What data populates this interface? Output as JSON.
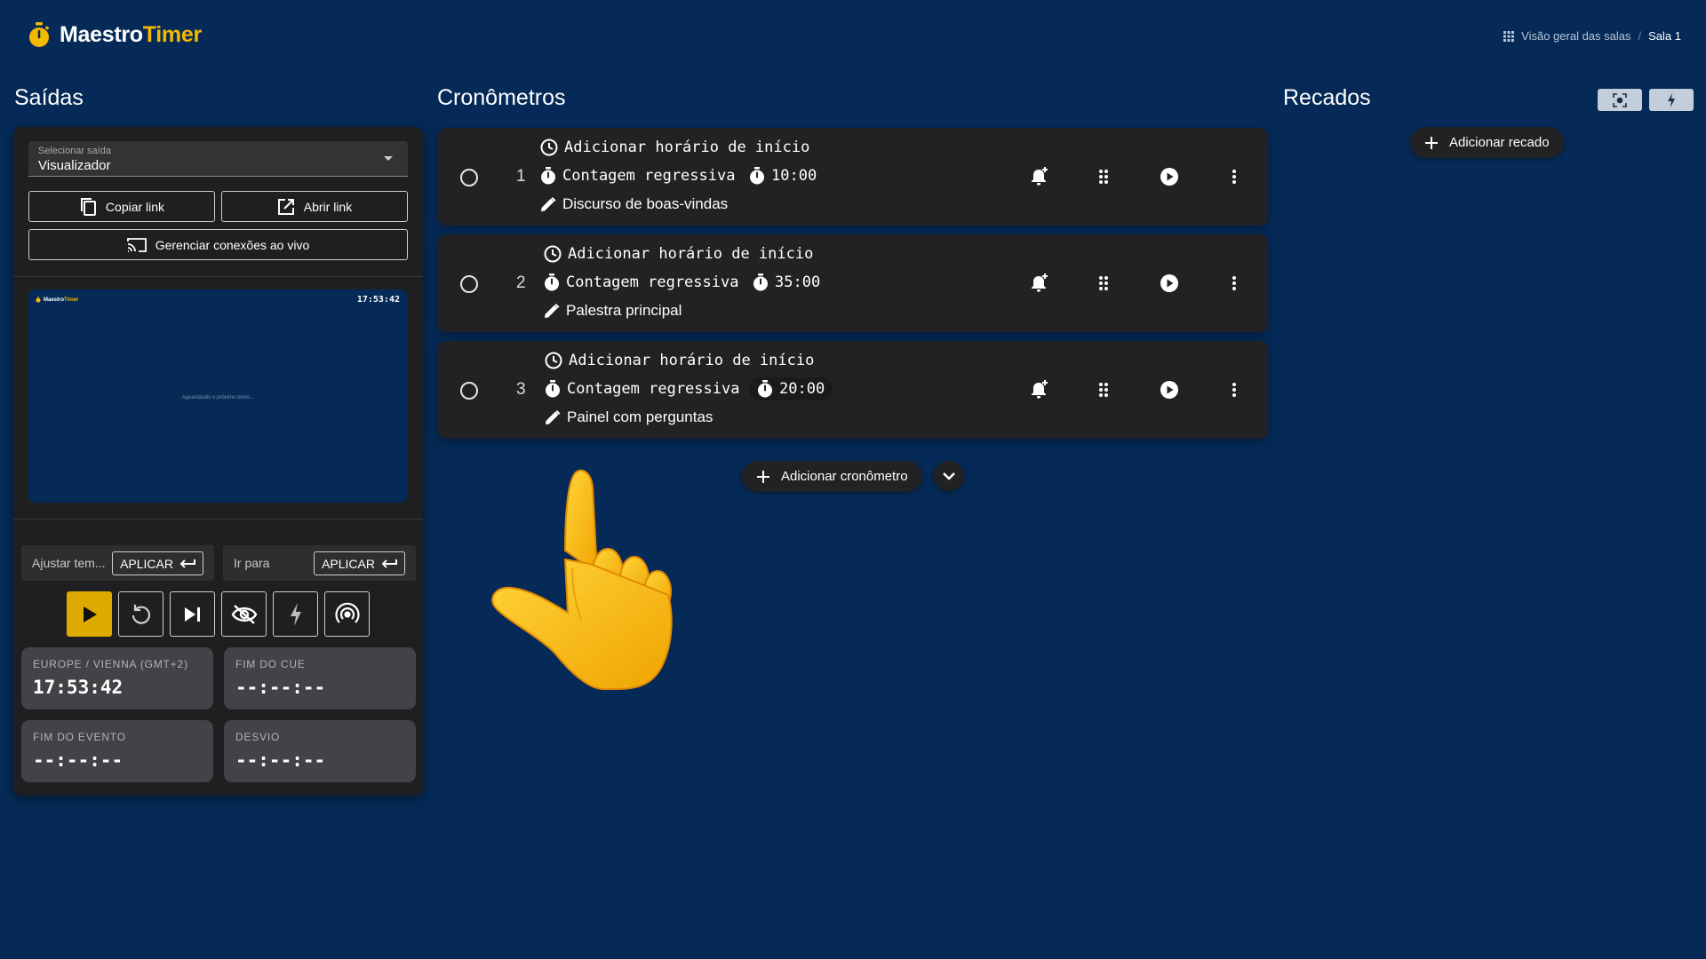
{
  "app": {
    "brand_part1": "Maestro",
    "brand_part2": "Timer"
  },
  "breadcrumb": {
    "overview": "Visão geral das salas",
    "separator": "/",
    "current": "Sala 1"
  },
  "sections": {
    "outputs": "Saídas",
    "timers": "Cronômetros",
    "messages": "Recados"
  },
  "outputs": {
    "select_label": "Selecionar saída",
    "select_value": "Visualizador",
    "copy_link": "Copiar link",
    "open_link": "Abrir link",
    "manage_connections": "Gerenciar conexões ao vivo",
    "preview": {
      "brand_part1": "Maestro",
      "brand_part2": "Timer",
      "time": "17:53:42",
      "waiting": "Aguardando o próximo bloco..."
    }
  },
  "controls": {
    "adjust_label": "Ajustar tem...",
    "goto_label": "Ir para",
    "apply": "APLICAR"
  },
  "info": {
    "clock_label": "EUROPE / VIENNA (GMT+2)",
    "clock_value": "17:53:42",
    "cue_end_label": "FIM DO CUE",
    "cue_end_value": "--:--:--",
    "event_end_label": "FIM DO EVENTO",
    "event_end_value": "--:--:--",
    "deviation_label": "DESVIO",
    "deviation_value": "--:--:--"
  },
  "timers": [
    {
      "index": "1",
      "start_time": "Adicionar horário de início",
      "mode": "Contagem regressiva",
      "duration": "10:00",
      "title": "Discurso de boas-vindas"
    },
    {
      "index": "2",
      "start_time": "Adicionar horário de início",
      "mode": "Contagem regressiva",
      "duration": "35:00",
      "title": "Palestra principal"
    },
    {
      "index": "3",
      "start_time": "Adicionar horário de início",
      "mode": "Contagem regressiva",
      "duration": "20:00",
      "title": "Painel com perguntas"
    }
  ],
  "add_timer": "Adicionar cronômetro",
  "add_message": "Adicionar recado",
  "colors": {
    "background": "#052a57",
    "card": "#222224",
    "accent": "#f5b800",
    "primary_button": "#dfaa00"
  },
  "icons": {
    "header": [
      "stopwatch-icon",
      "grid-icon"
    ],
    "timer_row": [
      "clock-icon",
      "stopwatch-icon",
      "pencil-icon",
      "bell-add-icon",
      "drag-handle-icon",
      "play-circle-icon",
      "more-vertical-icon"
    ],
    "controls": [
      "play-icon",
      "reset-icon",
      "skip-next-icon",
      "eye-off-icon",
      "flash-icon",
      "broadcast-icon"
    ],
    "misc": [
      "copy-icon",
      "open-external-icon",
      "cast-icon",
      "enter-icon",
      "plus-icon",
      "chevron-down-icon",
      "pointing-hand-icon"
    ]
  }
}
